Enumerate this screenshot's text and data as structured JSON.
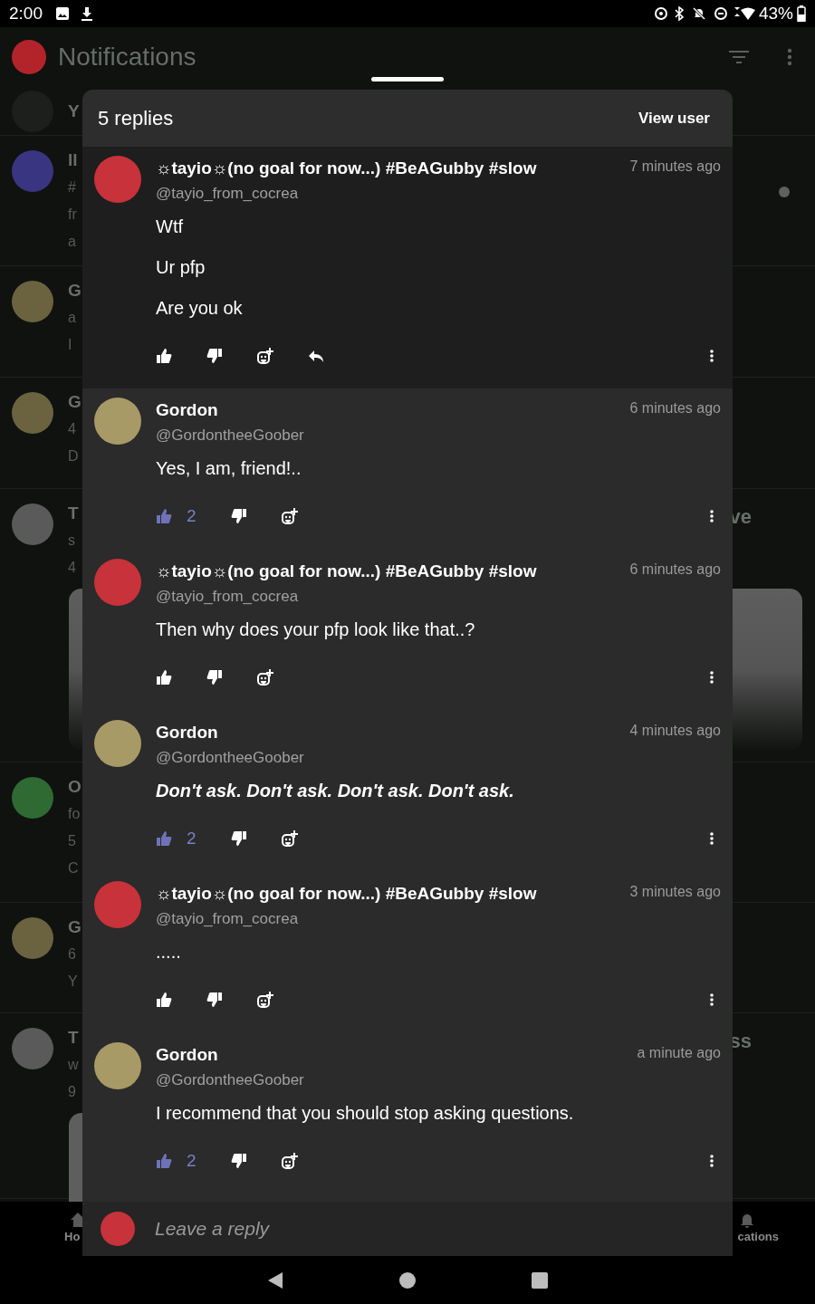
{
  "status_bar": {
    "time": "2:00",
    "battery": "43%"
  },
  "app_bar": {
    "title": "Notifications"
  },
  "background_rows": [
    {
      "lines": [
        "Y"
      ],
      "unread": false,
      "kind": "post"
    },
    {
      "lines": [
        "ll",
        "#",
        "fr",
        "a"
      ],
      "unread": true,
      "kind": "post"
    },
    {
      "lines": [
        "G",
        "a",
        "I"
      ],
      "unread": false,
      "kind": "post"
    },
    {
      "lines": [
        "G",
        "4",
        "D"
      ],
      "unread": false,
      "kind": "post"
    },
    {
      "lines": [
        "T",
        "s",
        "4"
      ],
      "unread": false,
      "trailing": "ve",
      "kind": "media"
    },
    {
      "lines": [
        "O",
        "fo",
        "5",
        "C"
      ],
      "unread": false,
      "kind": "post"
    },
    {
      "lines": [
        "G",
        "6",
        "Y"
      ],
      "unread": false,
      "kind": "post"
    },
    {
      "lines": [
        "T",
        "w",
        "9"
      ],
      "unread": false,
      "trailing": "ss",
      "kind": "clip"
    }
  ],
  "bottom_nav": [
    {
      "label": "Ho"
    },
    {
      "label": "cations"
    }
  ],
  "sheet": {
    "title": "5 replies",
    "action": "View user",
    "comments": [
      {
        "name": "☼tayio☼(no goal for now...) #BeAGubby #slow",
        "handle": "@tayio_from_cocrea",
        "time": "7 minutes ago",
        "body": [
          "Wtf",
          "Ur pfp",
          "Are you ok"
        ],
        "emphasis": false,
        "highlighted": true,
        "liked": false,
        "reply": true
      },
      {
        "name": "Gordon",
        "handle": "@GordontheeGoober",
        "time": "6 minutes ago",
        "body": [
          "Yes, I am, friend!.."
        ],
        "emphasis": false,
        "highlighted": false,
        "liked": true,
        "likes": "2",
        "reply": false
      },
      {
        "name": "☼tayio☼(no goal for now...) #BeAGubby #slow",
        "handle": "@tayio_from_cocrea",
        "time": "6 minutes ago",
        "body": [
          "Then why does your pfp look like that..?"
        ],
        "emphasis": false,
        "highlighted": false,
        "liked": false,
        "reply": false
      },
      {
        "name": "Gordon",
        "handle": "@GordontheeGoober",
        "time": "4 minutes ago",
        "body": [
          "Don't ask. Don't ask. Don't ask. Don't ask."
        ],
        "emphasis": true,
        "highlighted": false,
        "liked": true,
        "likes": "2",
        "reply": false
      },
      {
        "name": "☼tayio☼(no goal for now...) #BeAGubby #slow",
        "handle": "@tayio_from_cocrea",
        "time": "3 minutes ago",
        "body": [
          "....."
        ],
        "emphasis": false,
        "highlighted": false,
        "liked": false,
        "reply": false
      },
      {
        "name": "Gordon",
        "handle": "@GordontheeGoober",
        "time": "a minute ago",
        "body": [
          "I recommend that you should stop asking questions."
        ],
        "emphasis": false,
        "highlighted": false,
        "liked": true,
        "likes": "2",
        "reply": false
      }
    ],
    "reply_field": {
      "placeholder": "Leave a reply"
    }
  }
}
